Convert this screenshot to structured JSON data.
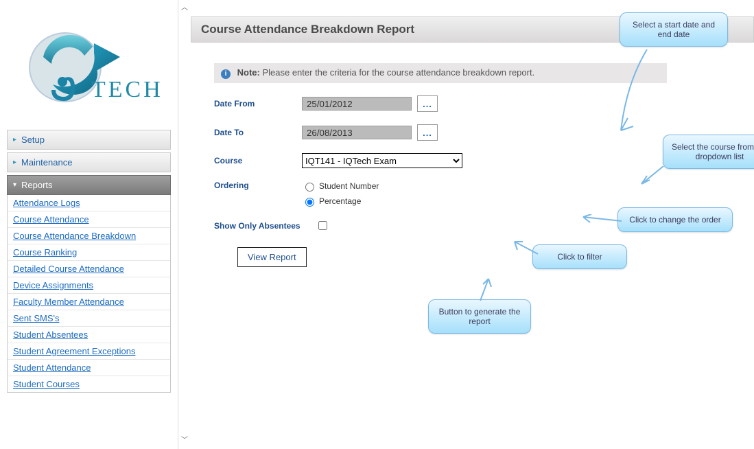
{
  "brand": {
    "name": "IQTech",
    "text_part": "TECH"
  },
  "nav": {
    "items": [
      {
        "label": "Setup",
        "expanded": false
      },
      {
        "label": "Maintenance",
        "expanded": false
      },
      {
        "label": "Reports",
        "expanded": true,
        "children": [
          "Attendance Logs",
          "Course Attendance",
          "Course Attendance Breakdown",
          "Course Ranking",
          "Detailed Course Attendance",
          "Device Assignments",
          "Faculty Member Attendance",
          "Sent SMS's",
          "Student Absentees",
          "Student Agreement Exceptions",
          "Student Attendance",
          "Student Courses"
        ]
      }
    ]
  },
  "page": {
    "title": "Course Attendance Breakdown Report",
    "note_prefix": "Note:",
    "note_text": "Please enter the criteria for the course attendance breakdown report."
  },
  "form": {
    "date_from_label": "Date From",
    "date_from_value": "25/01/2012",
    "date_to_label": "Date To",
    "date_to_value": "26/08/2013",
    "date_picker_glyph": "...",
    "course_label": "Course",
    "course_value": "IQT141 - IQTech Exam",
    "ordering_label": "Ordering",
    "ordering_options": [
      "Student Number",
      "Percentage"
    ],
    "ordering_selected": "Percentage",
    "absentees_label": "Show Only Absentees",
    "absentees_checked": false,
    "view_button": "View Report"
  },
  "callouts": {
    "dates": "Select a start date and end date",
    "course": "Select the course from the dropdown list",
    "order": "Click to change the order",
    "filter": "Click to filter",
    "button": "Button to generate the report"
  }
}
